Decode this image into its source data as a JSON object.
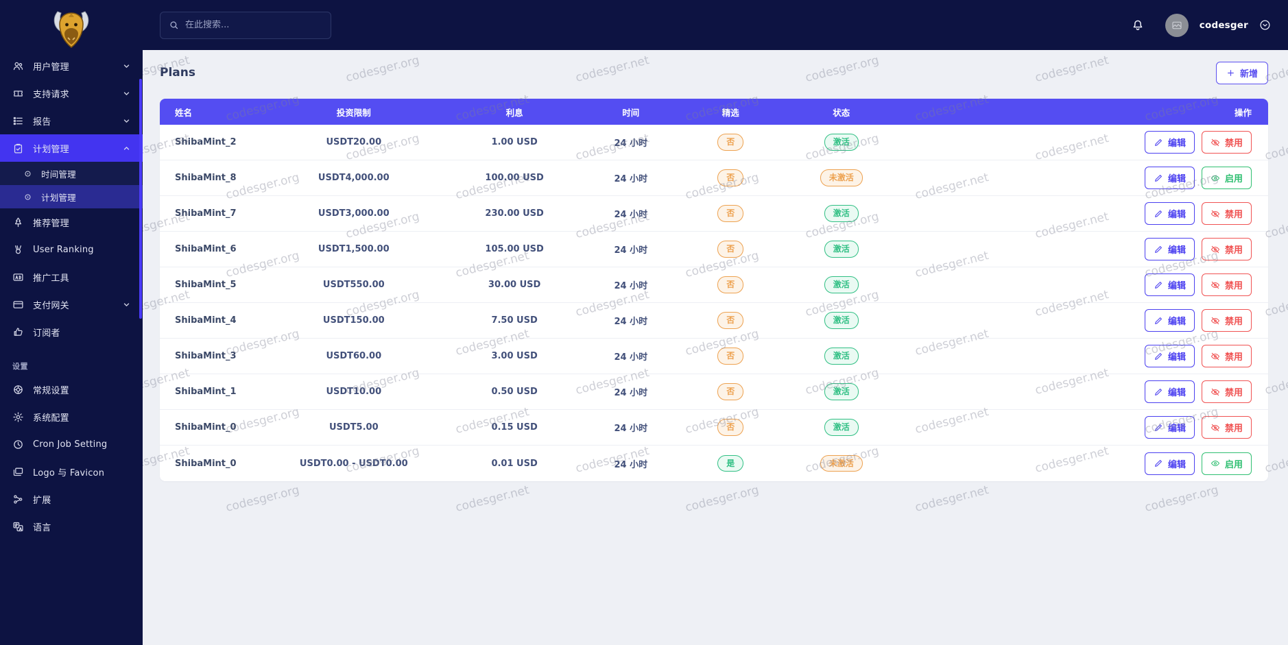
{
  "topbar": {
    "search_placeholder": "在此搜索...",
    "username": "codesger"
  },
  "sidebar": {
    "section_label": "设置",
    "items": [
      {
        "label": "用户管理",
        "icon": "users-icon",
        "chevron": "down",
        "clipped": true
      },
      {
        "label": "支持请求",
        "icon": "ticket-icon",
        "chevron": "down"
      },
      {
        "label": "报告",
        "icon": "report-icon",
        "chevron": "down"
      },
      {
        "label": "计划管理",
        "icon": "clipboard-icon",
        "chevron": "up",
        "active": true
      },
      {
        "label": "时间管理",
        "icon": "circle-dot-icon",
        "submenu": true
      },
      {
        "label": "计划管理",
        "icon": "circle-dot-icon",
        "submenu": true,
        "subactive": true
      },
      {
        "label": "推荐管理",
        "icon": "tree-icon"
      },
      {
        "label": "User Ranking",
        "icon": "medal-icon"
      },
      {
        "label": "推广工具",
        "icon": "ad-icon"
      },
      {
        "label": "支付网关",
        "icon": "card-icon",
        "chevron": "down"
      },
      {
        "label": "订阅者",
        "icon": "thumbs-up-icon"
      },
      {
        "type": "section",
        "label": "设置"
      },
      {
        "label": "常规设置",
        "icon": "globe-icon"
      },
      {
        "label": "系统配置",
        "icon": "gear-icon"
      },
      {
        "label": "Cron Job Setting",
        "icon": "clock-icon"
      },
      {
        "label": "Logo 与 Favicon",
        "icon": "images-icon"
      },
      {
        "label": "扩展",
        "icon": "nodes-icon"
      },
      {
        "label": "语言",
        "icon": "language-icon"
      }
    ]
  },
  "page": {
    "title": "Plans",
    "add_button_label": "新增"
  },
  "table": {
    "headers": [
      "姓名",
      "投资限制",
      "利息",
      "时间",
      "精选",
      "状态",
      "操作"
    ],
    "edit_label": "编辑",
    "rows": [
      {
        "name": "ShibaMint_2",
        "limit": "USDT20.00",
        "interest": "1.00 USD",
        "time": "24 小时",
        "featured": "否",
        "featured_variant": "warning",
        "status": "激活",
        "status_variant": "success",
        "action_label": "禁用",
        "action_variant": "danger",
        "action_icon": "eye-slash-icon"
      },
      {
        "name": "ShibaMint_8",
        "limit": "USDT4,000.00",
        "interest": "100.00 USD",
        "time": "24 小时",
        "featured": "否",
        "featured_variant": "warning",
        "status": "未激活",
        "status_variant": "warning",
        "action_label": "启用",
        "action_variant": "ok",
        "action_icon": "eye-icon"
      },
      {
        "name": "ShibaMint_7",
        "limit": "USDT3,000.00",
        "interest": "230.00 USD",
        "time": "24 小时",
        "featured": "否",
        "featured_variant": "warning",
        "status": "激活",
        "status_variant": "success",
        "action_label": "禁用",
        "action_variant": "danger",
        "action_icon": "eye-slash-icon"
      },
      {
        "name": "ShibaMint_6",
        "limit": "USDT1,500.00",
        "interest": "105.00 USD",
        "time": "24 小时",
        "featured": "否",
        "featured_variant": "warning",
        "status": "激活",
        "status_variant": "success",
        "action_label": "禁用",
        "action_variant": "danger",
        "action_icon": "eye-slash-icon"
      },
      {
        "name": "ShibaMint_5",
        "limit": "USDT550.00",
        "interest": "30.00 USD",
        "time": "24 小时",
        "featured": "否",
        "featured_variant": "warning",
        "status": "激活",
        "status_variant": "success",
        "action_label": "禁用",
        "action_variant": "danger",
        "action_icon": "eye-slash-icon"
      },
      {
        "name": "ShibaMint_4",
        "limit": "USDT150.00",
        "interest": "7.50 USD",
        "time": "24 小时",
        "featured": "否",
        "featured_variant": "warning",
        "status": "激活",
        "status_variant": "success",
        "action_label": "禁用",
        "action_variant": "danger",
        "action_icon": "eye-slash-icon"
      },
      {
        "name": "ShibaMint_3",
        "limit": "USDT60.00",
        "interest": "3.00 USD",
        "time": "24 小时",
        "featured": "否",
        "featured_variant": "warning",
        "status": "激活",
        "status_variant": "success",
        "action_label": "禁用",
        "action_variant": "danger",
        "action_icon": "eye-slash-icon"
      },
      {
        "name": "ShibaMint_1",
        "limit": "USDT10.00",
        "interest": "0.50 USD",
        "time": "24 小时",
        "featured": "否",
        "featured_variant": "warning",
        "status": "激活",
        "status_variant": "success",
        "action_label": "禁用",
        "action_variant": "danger",
        "action_icon": "eye-slash-icon"
      },
      {
        "name": "ShibaMint_0",
        "limit": "USDT5.00",
        "interest": "0.15 USD",
        "time": "24 小时",
        "featured": "否",
        "featured_variant": "warning",
        "status": "激活",
        "status_variant": "success",
        "action_label": "禁用",
        "action_variant": "danger",
        "action_icon": "eye-slash-icon"
      },
      {
        "name": "ShibaMint_0",
        "limit": "USDT0.00 - USDT0.00",
        "interest": "0.01 USD",
        "time": "24 小时",
        "featured": "是",
        "featured_variant": "success",
        "status": "未激活",
        "status_variant": "warning",
        "action_label": "启用",
        "action_variant": "ok",
        "action_icon": "eye-icon"
      }
    ]
  },
  "watermarks": [
    "codesger.net",
    "codesger.org"
  ],
  "colors": {
    "sidebar_bg": "#0d1342",
    "active_item": "#4334f0",
    "table_header": "#544df2",
    "badge_warning": "#eda14f",
    "badge_success": "#2fbf83",
    "edit_button": "#4a3ff0",
    "disable_button": "#f05252",
    "enable_button": "#2fbf71",
    "content_bg": "#eef0f5"
  }
}
